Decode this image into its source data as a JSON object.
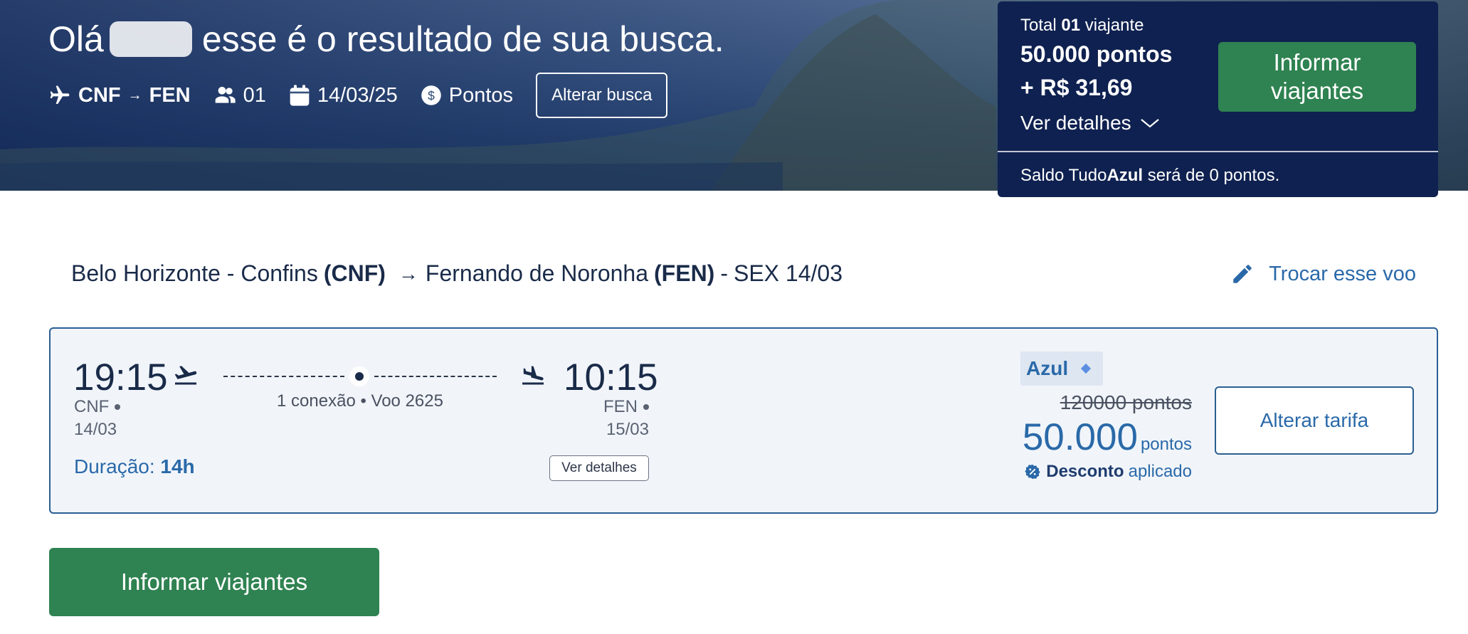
{
  "hero": {
    "greeting_prefix": "Olá",
    "greeting_suffix": "esse é o resultado de sua busca.",
    "origin": "CNF",
    "destination": "FEN",
    "arrow": "→",
    "passengers": "01",
    "date": "14/03/25",
    "payment": "Pontos",
    "alter_search_label": "Alterar busca"
  },
  "summary": {
    "total_prefix": "Total",
    "travelers_count": "01",
    "travelers_suffix": "viajante",
    "points": "50.000 pontos",
    "cash": "+ R$ 31,69",
    "details_label": "Ver detalhes",
    "button_label": "Informar viajantes",
    "saldo_prefix": "Saldo Tudo",
    "saldo_brand": "Azul",
    "saldo_suffix": "será de 0 pontos."
  },
  "route": {
    "origin_city": "Belo Horizonte - Confins",
    "origin_code": "(CNF)",
    "arrow": "→",
    "dest_city": "Fernando de Noronha",
    "dest_code": "(FEN)",
    "separator": "-",
    "date_label": "SEX 14/03",
    "change_flight_label": "Trocar esse voo"
  },
  "flight": {
    "departure_time": "19:15",
    "departure_code": "CNF",
    "departure_date": "14/03",
    "arrival_time": "10:15",
    "arrival_code": "FEN",
    "arrival_date": "15/03",
    "connection_info": "1 conexão • Voo 2625",
    "duration_label": "Duração:",
    "duration_value": "14h",
    "details_button": "Ver detalhes"
  },
  "fare": {
    "brand": "Azul",
    "old_price": "120000 pontos",
    "new_price": "50.000",
    "unit": "pontos",
    "discount_bold": "Desconto",
    "discount_rest": "aplicado",
    "change_fare_label": "Alterar tarifa"
  },
  "footer": {
    "button_label": "Informar viajantes"
  },
  "colors": {
    "navy": "#0f2150",
    "green": "#2f8251",
    "blue_link": "#2a69a8",
    "card_bg": "#f1f5fa"
  },
  "icons": [
    "airplane-icon",
    "people-icon",
    "calendar-icon",
    "coin-icon",
    "chevron-down-icon",
    "pencil-icon",
    "takeoff-icon",
    "landing-icon",
    "discount-badge-icon"
  ]
}
